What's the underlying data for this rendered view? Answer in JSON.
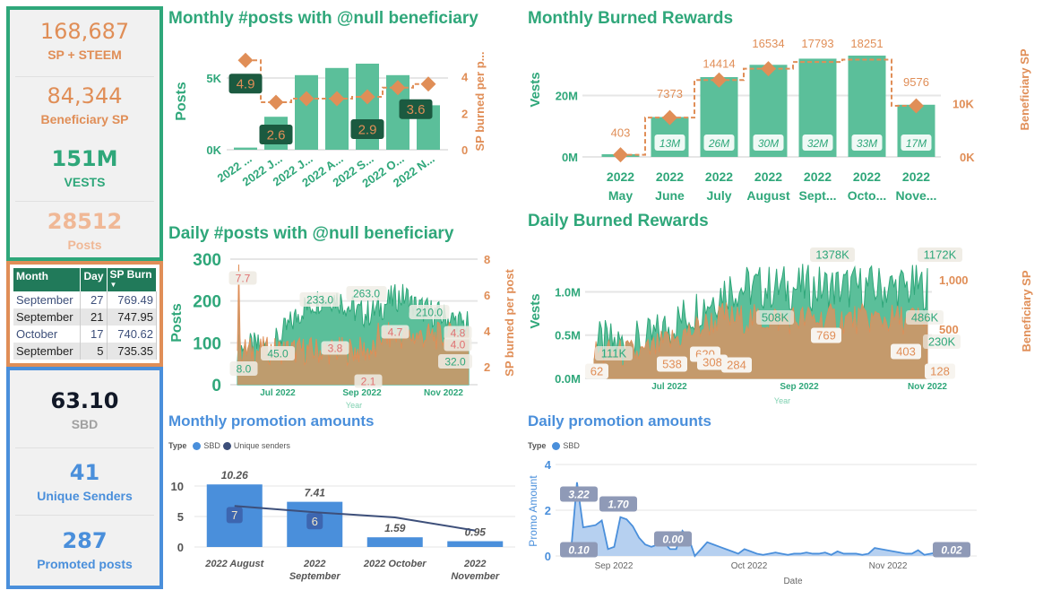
{
  "kpis_top": [
    {
      "value": "168,687",
      "label": "SP + STEEM",
      "value_color": "#e08e57",
      "label_color": "#e08e57"
    },
    {
      "value": "84,344",
      "label": "Beneficiary SP",
      "value_color": "#e08e57",
      "label_color": "#e08e57"
    },
    {
      "value": "151M",
      "label": "VESTS",
      "value_color": "#2fa77a",
      "label_color": "#2fa77a"
    },
    {
      "value": "28512",
      "label": "Posts",
      "value_color": "#f0b896",
      "label_color": "#f0b896"
    }
  ],
  "burn_table": {
    "headers": [
      "Month",
      "Day",
      "SP Burn"
    ],
    "sort_indicator": "▼",
    "rows": [
      [
        "September",
        "27",
        "769.49"
      ],
      [
        "September",
        "21",
        "747.95"
      ],
      [
        "October",
        "17",
        "740.62"
      ],
      [
        "September",
        "5",
        "735.35"
      ]
    ]
  },
  "kpis_bottom": [
    {
      "value": "63.10",
      "label": "SBD",
      "value_color": "#111827",
      "label_color": "#a0a0a0"
    },
    {
      "value": "41",
      "label": "Unique Senders",
      "value_color": "#4a8fdb",
      "label_color": "#4a8fdb"
    },
    {
      "value": "287",
      "label": "Promoted posts",
      "value_color": "#4a8fdb",
      "label_color": "#4a8fdb"
    }
  ],
  "colors": {
    "green": "#5bbf9a",
    "green_dark": "#2fa77a",
    "orange": "#e08e57",
    "blue": "#4a8fdb",
    "navy": "#3d4f7a",
    "label_dark": "#1b5a40"
  },
  "chart_data": [
    {
      "id": "monthly_posts",
      "type": "bar",
      "title": "Monthly #posts with @null beneficiary",
      "categories": [
        "2022 ...",
        "2022 J...",
        "2022 J...",
        "2022 A...",
        "2022 S...",
        "2022 O...",
        "2022 N..."
      ],
      "series": [
        {
          "name": "Posts",
          "axis": "left",
          "type": "bar",
          "values": [
            150,
            2300,
            5200,
            5700,
            6000,
            5200,
            3100
          ]
        },
        {
          "name": "SP burned per post",
          "axis": "right",
          "type": "step-line",
          "values": [
            4.9,
            2.6,
            2.8,
            2.8,
            2.9,
            3.4,
            3.6
          ]
        }
      ],
      "data_labels": [
        {
          "index": 0,
          "text": "4.9"
        },
        {
          "index": 1,
          "text": "2.6"
        },
        {
          "index": 4,
          "text": "2.9"
        },
        {
          "index": 6,
          "text": "3.6"
        }
      ],
      "ylabel": "Posts",
      "y2label": "SP burned per p...",
      "yticks": [
        "0K",
        "5K"
      ],
      "ylim": [
        0,
        7000
      ],
      "y2ticks": [
        "0",
        "2",
        "4"
      ],
      "y2lim": [
        0,
        5.5
      ]
    },
    {
      "id": "monthly_burned",
      "type": "bar",
      "title": "Monthly Burned Rewards",
      "categories": [
        [
          "2022",
          "May"
        ],
        [
          "2022",
          "June"
        ],
        [
          "2022",
          "July"
        ],
        [
          "2022",
          "August"
        ],
        [
          "2022",
          "Sept..."
        ],
        [
          "2022",
          "Octo..."
        ],
        [
          "2022",
          "Nove..."
        ]
      ],
      "series": [
        {
          "name": "Vests",
          "axis": "left",
          "type": "bar",
          "values": [
            0.8,
            13,
            26,
            30,
            32,
            33,
            17
          ],
          "labels": [
            "",
            "13M",
            "26M",
            "30M",
            "32M",
            "33M",
            "17M"
          ]
        },
        {
          "name": "Beneficiary SP",
          "axis": "right",
          "type": "step-line",
          "values": [
            403,
            7373,
            14414,
            16534,
            17793,
            18251,
            9576
          ]
        }
      ],
      "ylabel": "Vests",
      "y2label": "Beneficiary SP",
      "yticks": [
        "0M",
        "20M"
      ],
      "ylim": [
        0,
        33
      ],
      "y2ticks": [
        "0K",
        "10K"
      ],
      "y2lim": [
        0,
        17000
      ]
    },
    {
      "id": "daily_posts",
      "type": "area",
      "title": "Daily #posts with @null beneficiary",
      "xlabel": "Year",
      "xticks": [
        "Jul 2022",
        "Sep 2022",
        "Nov 2022"
      ],
      "ylabel": "Posts",
      "y2label": "SP burned per post",
      "yticks": [
        "0",
        "100",
        "200",
        "300"
      ],
      "ylim": [
        0,
        300
      ],
      "y2ticks": [
        "2",
        "4",
        "6",
        "8"
      ],
      "y2lim": [
        1,
        8
      ],
      "annotations_left": [
        {
          "text": "8.0"
        },
        {
          "text": "45.0"
        },
        {
          "text": "233.0"
        },
        {
          "text": "263.0"
        },
        {
          "text": "210.0"
        },
        {
          "text": "32.0"
        }
      ],
      "annotations_right": [
        {
          "text": "7.7"
        },
        {
          "text": "3.8"
        },
        {
          "text": "2.1"
        },
        {
          "text": "4.7"
        },
        {
          "text": "4.8"
        },
        {
          "text": "4.0"
        }
      ]
    },
    {
      "id": "daily_burned",
      "type": "area",
      "title": "Daily Burned Rewards",
      "xlabel": "Year",
      "xticks": [
        "Jul 2022",
        "Sep 2022",
        "Nov 2022"
      ],
      "ylabel": "Vests",
      "y2label": "Beneficiary SP",
      "yticks": [
        "0.0M",
        "0.5M",
        "1.0M"
      ],
      "ylim": [
        0,
        1.5
      ],
      "y2ticks": [
        "500",
        "1,000"
      ],
      "y2lim": [
        0,
        1200
      ],
      "annotations_left": [
        {
          "text": "111K"
        },
        {
          "text": "508K"
        },
        {
          "text": "1378K"
        },
        {
          "text": "1172K"
        },
        {
          "text": "486K"
        },
        {
          "text": "230K"
        }
      ],
      "annotations_right": [
        {
          "text": "62"
        },
        {
          "text": "538"
        },
        {
          "text": "620"
        },
        {
          "text": "308"
        },
        {
          "text": "284"
        },
        {
          "text": "769"
        },
        {
          "text": "403"
        },
        {
          "text": "128"
        }
      ]
    },
    {
      "id": "monthly_promo",
      "type": "bar",
      "title": "Monthly promotion amounts",
      "legend_title": "Type",
      "legend": [
        "SBD",
        "Unique senders"
      ],
      "categories": [
        [
          "2022 August"
        ],
        [
          "2022",
          "September"
        ],
        [
          "2022 October"
        ],
        [
          "2022",
          "November"
        ]
      ],
      "series": [
        {
          "name": "SBD",
          "type": "bar",
          "values": [
            10.26,
            7.41,
            1.59,
            0.95
          ]
        },
        {
          "name": "Unique senders",
          "type": "line",
          "values": [
            7,
            6,
            5,
            3
          ]
        }
      ],
      "bar_labels": [
        "10.26",
        "7.41",
        "1.59",
        "0.95"
      ],
      "line_labels": [
        "7",
        "6",
        "",
        ""
      ],
      "yticks": [
        "0",
        "5",
        "10"
      ],
      "ylim": [
        0,
        12.5
      ]
    },
    {
      "id": "daily_promo",
      "type": "area",
      "title": "Daily promotion amounts",
      "legend_title": "Type",
      "legend": [
        "SBD"
      ],
      "xlabel": "Date",
      "ylabel": "Promo Amount",
      "xticks": [
        "Sep 2022",
        "Oct 2022",
        "Nov 2022"
      ],
      "yticks": [
        "0",
        "2",
        "4"
      ],
      "ylim": [
        0,
        4
      ],
      "values": [
        0.1,
        3.22,
        1.25,
        1.3,
        1.35,
        1.55,
        0.3,
        0.4,
        1.7,
        1.6,
        1.3,
        0.8,
        0.5,
        0.4,
        0.5,
        0.6,
        0.3,
        0.3,
        1.1,
        0.8,
        0.0,
        0.3,
        0.6,
        0.5,
        0.4,
        0.3,
        0.2,
        0.1,
        0.3,
        0.2,
        0.1,
        0.05,
        0.1,
        0.15,
        0.1,
        0.05,
        0.1,
        0.1,
        0.15,
        0.1,
        0.1,
        0.15,
        0.05,
        0.2,
        0.1,
        0.1,
        0.1,
        0.05,
        0.1,
        0.35,
        0.3,
        0.25,
        0.2,
        0.15,
        0.1,
        0.1,
        0.25,
        0.05,
        0.1,
        0.15,
        0.05,
        0.25,
        0.15,
        0.1,
        0.02
      ],
      "annotations": [
        {
          "text": "3.22"
        },
        {
          "text": "1.70"
        },
        {
          "text": "0.10"
        },
        {
          "text": "0.00"
        },
        {
          "text": "0.02"
        }
      ]
    }
  ]
}
